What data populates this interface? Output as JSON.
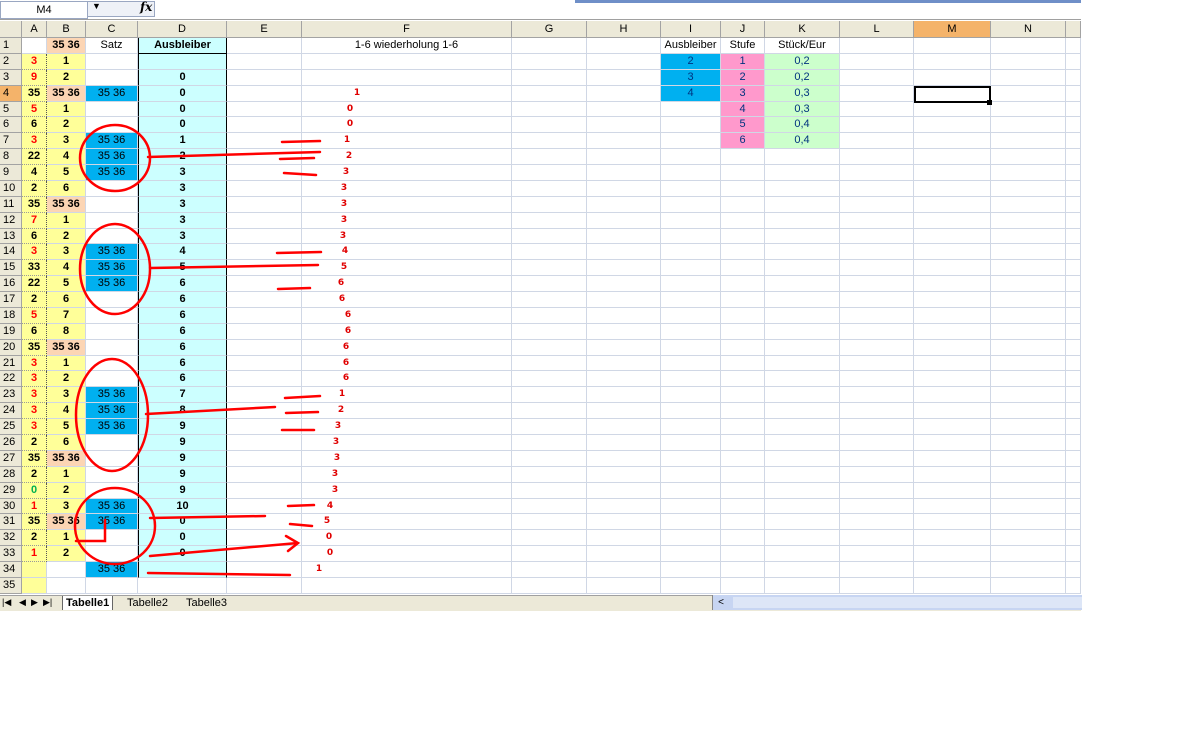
{
  "namebox": "M4",
  "fx_label": "fx",
  "columns": [
    "A",
    "B",
    "C",
    "D",
    "E",
    "F",
    "G",
    "H",
    "I",
    "J",
    "K",
    "L",
    "M",
    "N"
  ],
  "selected_col": "M",
  "selected_row": 4,
  "header_row": {
    "B": "35 36",
    "C": "Satz",
    "D": "Ausbleiber",
    "F": "1-6 wiederholung 1-6",
    "I": "Ausbleiber",
    "J": "Stufe",
    "K": "Stück/Eur"
  },
  "col_a": [
    "3",
    "9",
    "35",
    "5",
    "6",
    "3",
    "22",
    "4",
    "2",
    "35",
    "7",
    "6",
    "3",
    "33",
    "22",
    "2",
    "5",
    "6",
    "35",
    "3",
    "3",
    "3",
    "3",
    "3",
    "2",
    "35",
    "2",
    "0",
    "1",
    "35",
    "2",
    "1"
  ],
  "col_b": [
    "1",
    "2",
    "35 36",
    "1",
    "2",
    "3",
    "4",
    "5",
    "6",
    "35 36",
    "1",
    "2",
    "3",
    "4",
    "5",
    "6",
    "7",
    "8",
    "35 36",
    "1",
    "2",
    "3",
    "4",
    "5",
    "6",
    "35 36",
    "1",
    "2",
    "3",
    "35 36",
    "1",
    "2"
  ],
  "col_c": {
    "4": "35 36",
    "7": "35 36",
    "8": "35 36",
    "9": "35 36",
    "14": "35 36",
    "15": "35 36",
    "16": "35 36",
    "23": "35 36",
    "24": "35 36",
    "25": "35 36",
    "30": "35 36",
    "31": "35 36",
    "34": "35 36"
  },
  "col_d": [
    "",
    "0",
    "0",
    "0",
    "0",
    "1",
    "2",
    "3",
    "3",
    "3",
    "3",
    "3",
    "4",
    "5",
    "6",
    "6",
    "6",
    "6",
    "6",
    "6",
    "6",
    "7",
    "8",
    "9",
    "9",
    "9",
    "9",
    "9",
    "10",
    "0",
    "0",
    "0"
  ],
  "col_f": [
    "",
    "",
    "1",
    "0",
    "0",
    "1",
    "2",
    "3",
    "3",
    "3",
    "3",
    "3",
    "4",
    "5",
    "6",
    "6",
    "6",
    "6",
    "6",
    "6",
    "6",
    "1",
    "2",
    "3",
    "3",
    "3",
    "3",
    "3",
    "4",
    "5",
    "0",
    "0",
    "1"
  ],
  "table_i": [
    "2",
    "3",
    "4"
  ],
  "table_j": [
    "1",
    "2",
    "3",
    "4",
    "5",
    "6"
  ],
  "table_k": [
    "0,2",
    "0,2",
    "0,3",
    "0,3",
    "0,4",
    "0,4"
  ],
  "sheet_tabs": [
    "Tabelle1",
    "Tabelle2",
    "Tabelle3"
  ],
  "colors": {
    "yellow": "#ffff99",
    "tan": "#fcd5b4",
    "cyan": "#00b0f0",
    "lightcyan": "#ccffff",
    "pink": "#ff99cc",
    "green": "#ccffcc",
    "red": "#ff0000",
    "ink": "#e00000"
  }
}
